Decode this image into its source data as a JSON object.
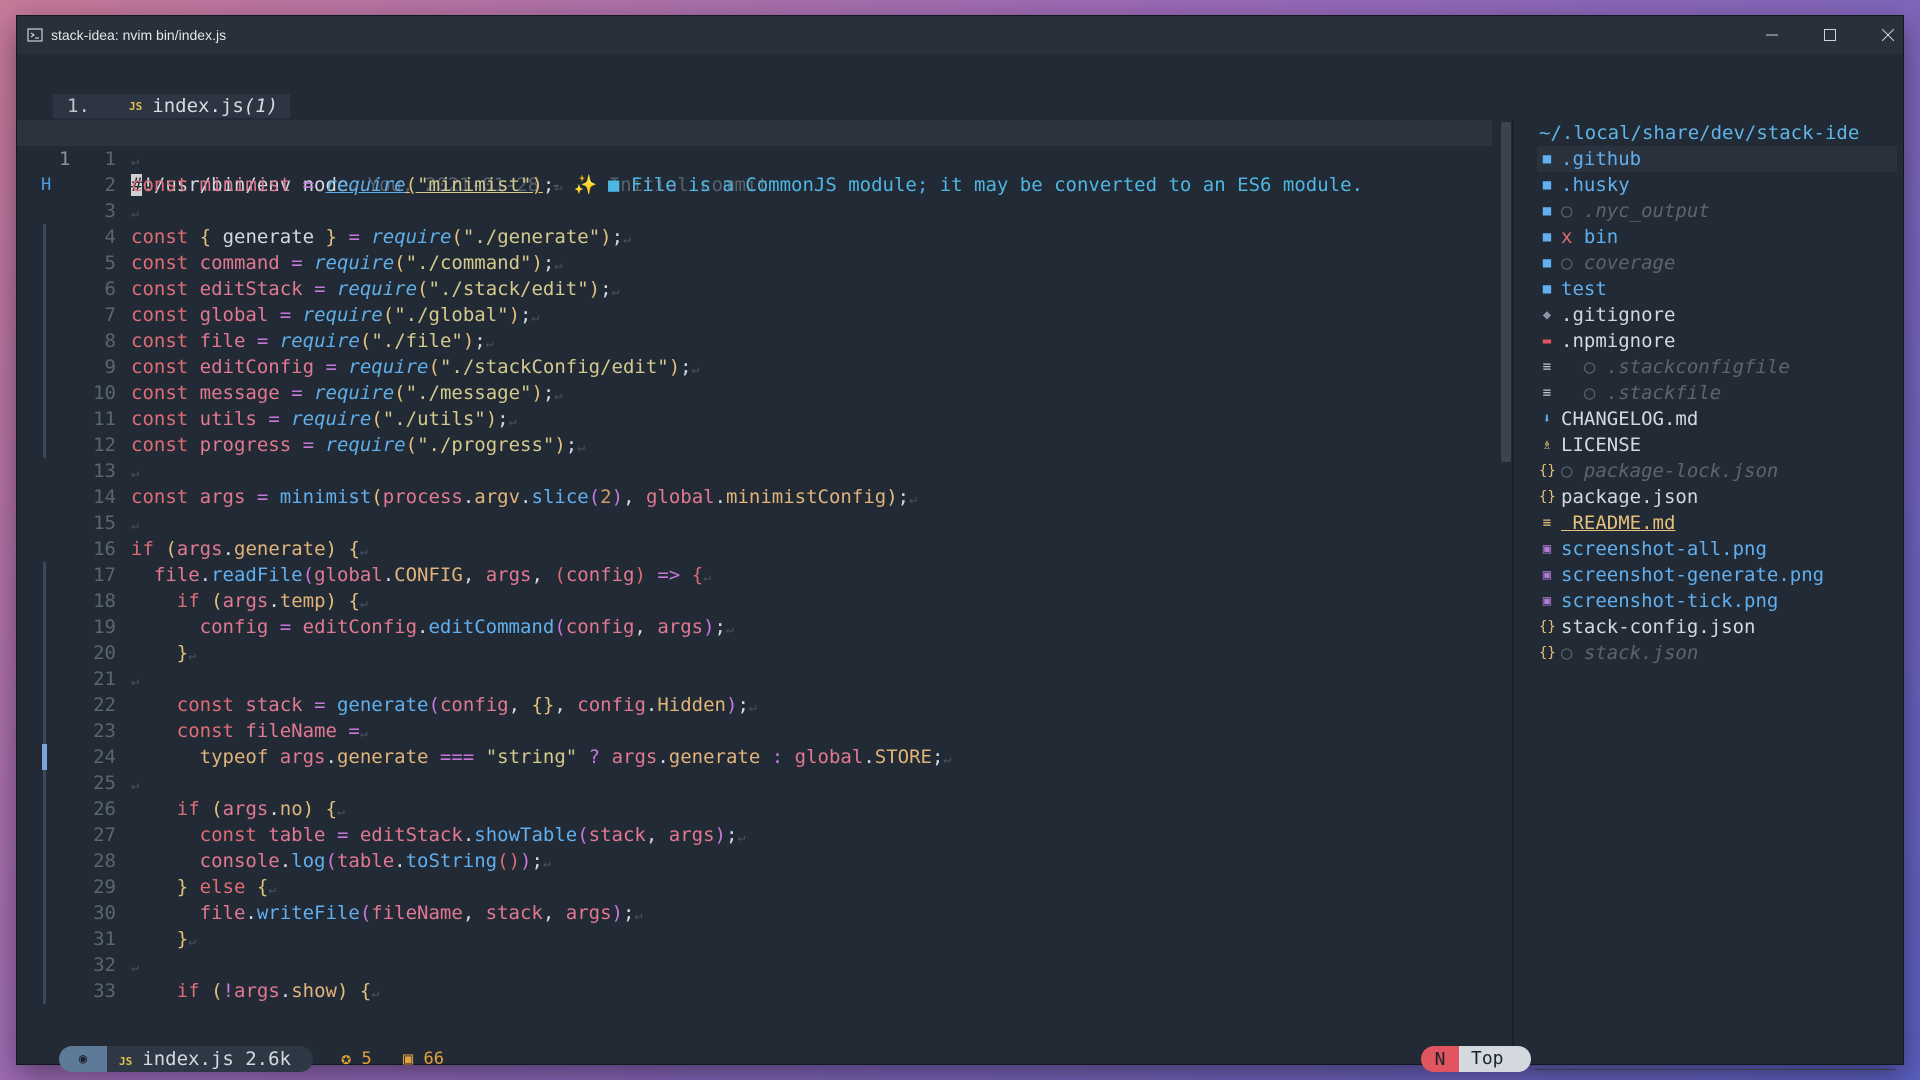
{
  "window": {
    "title": "stack-idea: nvim bin/index.js"
  },
  "tab": {
    "number": "1.",
    "icon": "JS",
    "name": "index.js",
    "count": "(1)"
  },
  "line1": {
    "num": "1",
    "cursor": "#",
    "text": "!/usr/bin/env node",
    "blame": " You, 2021-01-28 - ",
    "blame_icon": "✨",
    "blame_msg": " Initial commit"
  },
  "diagnostic": {
    "sign": "H",
    "marker": "■",
    "text": "File is a CommonJS module; it may be converted to an ES6 module."
  },
  "line_numbers": [
    "1",
    "2",
    "3",
    "4",
    "5",
    "6",
    "7",
    "8",
    "9",
    "10",
    "11",
    "12",
    "13",
    "14",
    "15",
    "16",
    "17",
    "18",
    "19",
    "20",
    "21",
    "22",
    "23",
    "24",
    "25",
    "26",
    "27",
    "28",
    "29",
    "30",
    "31",
    "32",
    "33"
  ],
  "tree": {
    "root": "~/.local/share/dev/stack-ide",
    "items": [
      {
        "name": ".github",
        "kind": "dir",
        "icon": "folder-icon"
      },
      {
        "name": ".husky",
        "kind": "dir",
        "icon": "folder-icon"
      },
      {
        "name": ".nyc_output",
        "kind": "dir-ignored",
        "icon": "folder-icon"
      },
      {
        "name": "bin",
        "kind": "dir",
        "icon": "folder-icon",
        "mark": "x"
      },
      {
        "name": "coverage",
        "kind": "dir-ignored",
        "icon": "folder-icon"
      },
      {
        "name": "test",
        "kind": "dir",
        "icon": "folder-icon"
      },
      {
        "name": ".gitignore",
        "kind": "file",
        "icon": "git-icon"
      },
      {
        "name": ".npmignore",
        "kind": "file",
        "icon": "npm-icon"
      },
      {
        "name": ".stackconfigfile",
        "kind": "ignored",
        "icon": "text-file-icon"
      },
      {
        "name": ".stackfile",
        "kind": "ignored",
        "icon": "text-file-icon"
      },
      {
        "name": "CHANGELOG.md",
        "kind": "file",
        "icon": "markdown-icon"
      },
      {
        "name": "LICENSE",
        "kind": "file",
        "icon": "license-icon"
      },
      {
        "name": "package-lock.json",
        "kind": "ignored",
        "icon": "json-icon"
      },
      {
        "name": "package.json",
        "kind": "file",
        "icon": "json-icon"
      },
      {
        "name": "README.md",
        "kind": "readme",
        "icon": "text-file-icon"
      },
      {
        "name": "screenshot-all.png",
        "kind": "png",
        "icon": "image-icon"
      },
      {
        "name": "screenshot-generate.png",
        "kind": "png",
        "icon": "image-icon"
      },
      {
        "name": "screenshot-tick.png",
        "kind": "png",
        "icon": "image-icon"
      },
      {
        "name": "stack-config.json",
        "kind": "file",
        "icon": "json-icon"
      },
      {
        "name": "stack.json",
        "kind": "ignored",
        "icon": "json-icon"
      }
    ]
  },
  "status": {
    "file_icon": "JS",
    "file": "index.js",
    "size": "2.6k",
    "warnings": "5",
    "errors": "66",
    "mode": "N",
    "position": "Top"
  },
  "colors": {
    "accent": "#61afef",
    "mode_normal": "#e05560",
    "warning": "#e5a13d"
  }
}
